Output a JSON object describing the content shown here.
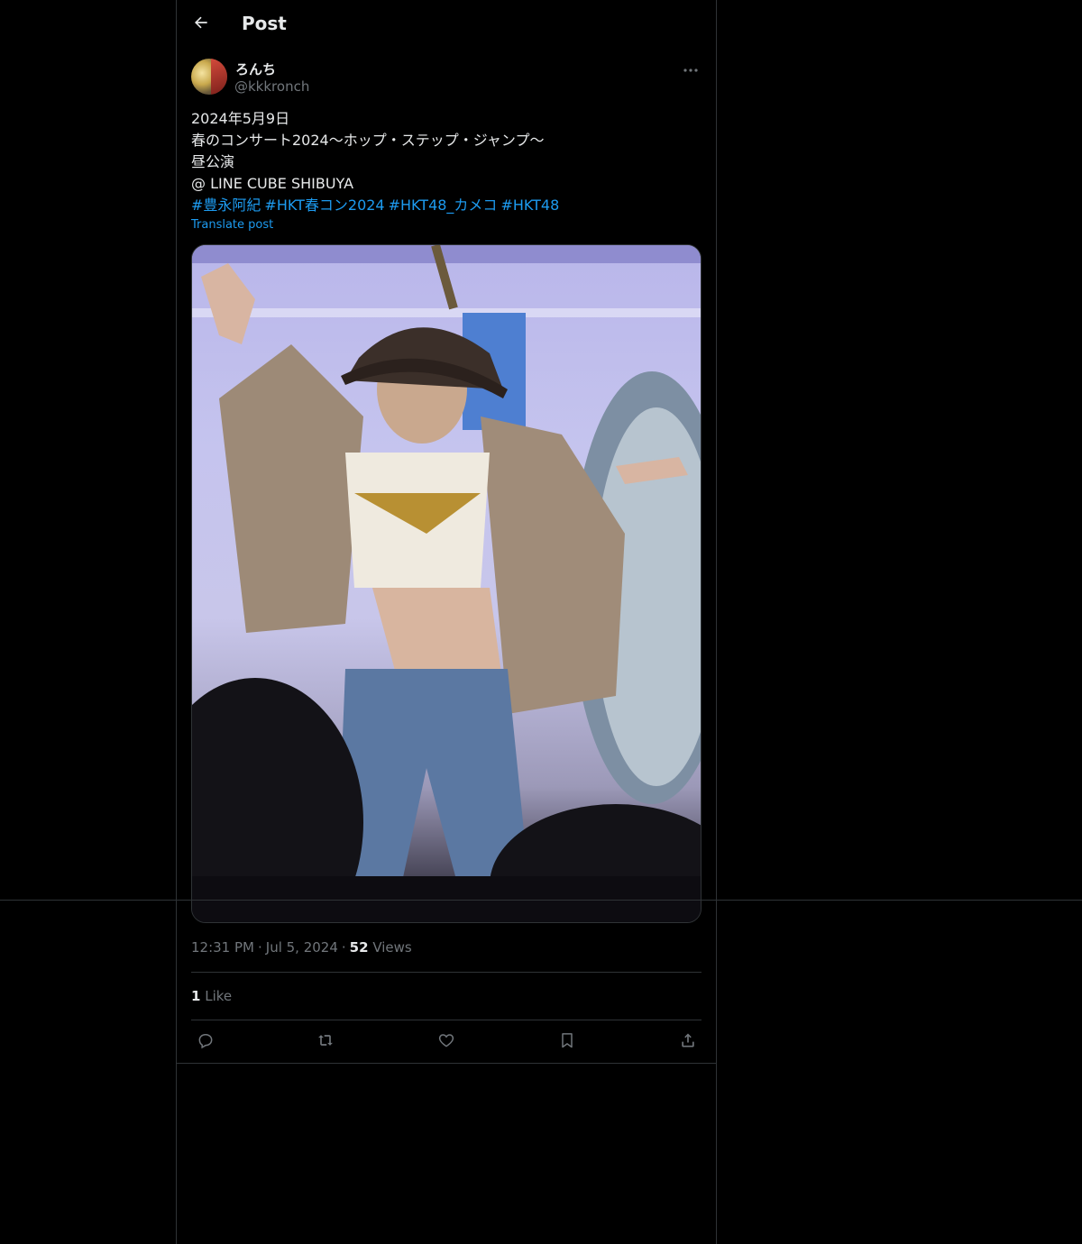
{
  "header": {
    "title": "Post"
  },
  "author": {
    "display_name": "ろんち",
    "handle": "@kkkronch"
  },
  "tweet": {
    "lines": [
      "2024年5月9日",
      "春のコンサート2024〜ホップ・ステップ・ジャンプ〜",
      "昼公演",
      "@ LINE CUBE SHIBUYA"
    ],
    "hashtags": [
      "#豊永阿紀",
      "#HKT春コン2024",
      "#HKT48_カメコ",
      "#HKT48"
    ],
    "translate_label": "Translate post"
  },
  "meta": {
    "time": "12:31 PM",
    "date": "Jul 5, 2024",
    "views_count": "52",
    "views_label": "Views"
  },
  "likes": {
    "count": "1",
    "label": "Like"
  },
  "icons": {
    "back": "back-arrow-icon",
    "more": "more-icon",
    "reply": "reply-icon",
    "repost": "repost-icon",
    "like": "like-icon",
    "bookmark": "bookmark-icon",
    "share": "share-icon"
  },
  "colors": {
    "background": "#000000",
    "text": "#e7e9ea",
    "muted": "#71767b",
    "accent": "#1d9bf0",
    "border": "#2f3336"
  }
}
